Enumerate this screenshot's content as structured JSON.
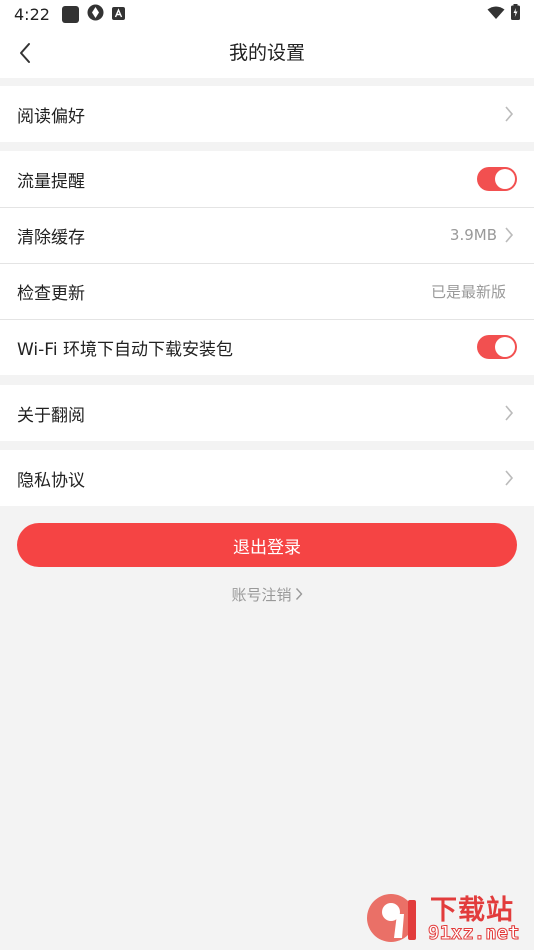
{
  "status_bar": {
    "time": "4:22",
    "icons": [
      "notification-square-icon",
      "vpn-icon",
      "keyboard-a-icon"
    ],
    "right_icons": [
      "wifi-icon",
      "battery-icon"
    ]
  },
  "header": {
    "title": "我的设置",
    "back_icon": "back-chevron-icon"
  },
  "groups": {
    "reading": {
      "label": "阅读偏好"
    },
    "data_alert": {
      "label": "流量提醒",
      "toggle_on": true
    },
    "clear_cache": {
      "label": "清除缓存",
      "value": "3.9MB"
    },
    "check_update": {
      "label": "检查更新",
      "value": "已是最新版"
    },
    "wifi_download": {
      "label": "Wi-Fi 环境下自动下载安装包",
      "toggle_on": true
    },
    "about": {
      "label": "关于翻阅"
    },
    "privacy": {
      "label": "隐私协议"
    }
  },
  "logout": {
    "label": "退出登录"
  },
  "cancel_account": {
    "label": "账号注销"
  },
  "watermark": {
    "cn": "下载站",
    "en": "91xz.net",
    "logo_text": "9"
  },
  "colors": {
    "accent": "#f54444",
    "toggle": "#f25050",
    "background": "#f3f3f3"
  }
}
